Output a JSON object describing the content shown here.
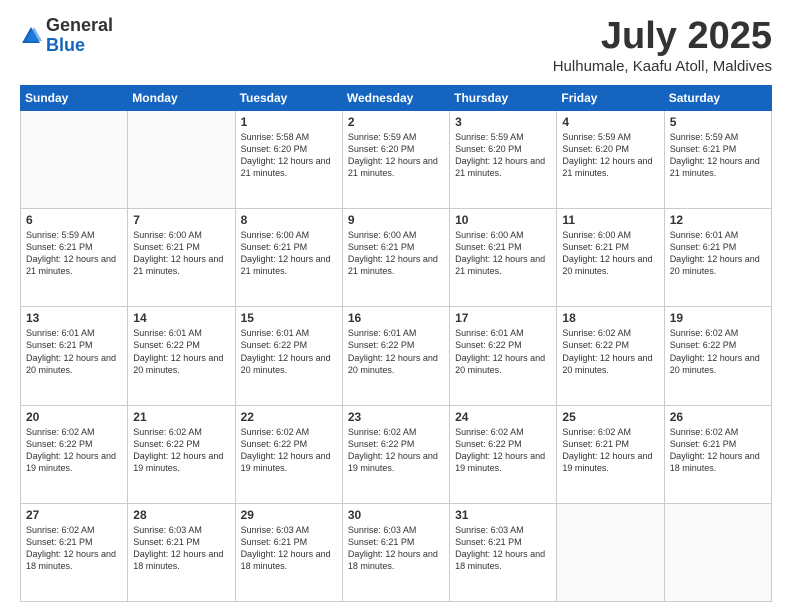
{
  "logo": {
    "general": "General",
    "blue": "Blue"
  },
  "header": {
    "month": "July 2025",
    "location": "Hulhumale, Kaafu Atoll, Maldives"
  },
  "weekdays": [
    "Sunday",
    "Monday",
    "Tuesday",
    "Wednesday",
    "Thursday",
    "Friday",
    "Saturday"
  ],
  "weeks": [
    [
      {
        "day": "",
        "info": ""
      },
      {
        "day": "",
        "info": ""
      },
      {
        "day": "1",
        "info": "Sunrise: 5:58 AM\nSunset: 6:20 PM\nDaylight: 12 hours and 21 minutes."
      },
      {
        "day": "2",
        "info": "Sunrise: 5:59 AM\nSunset: 6:20 PM\nDaylight: 12 hours and 21 minutes."
      },
      {
        "day": "3",
        "info": "Sunrise: 5:59 AM\nSunset: 6:20 PM\nDaylight: 12 hours and 21 minutes."
      },
      {
        "day": "4",
        "info": "Sunrise: 5:59 AM\nSunset: 6:20 PM\nDaylight: 12 hours and 21 minutes."
      },
      {
        "day": "5",
        "info": "Sunrise: 5:59 AM\nSunset: 6:21 PM\nDaylight: 12 hours and 21 minutes."
      }
    ],
    [
      {
        "day": "6",
        "info": "Sunrise: 5:59 AM\nSunset: 6:21 PM\nDaylight: 12 hours and 21 minutes."
      },
      {
        "day": "7",
        "info": "Sunrise: 6:00 AM\nSunset: 6:21 PM\nDaylight: 12 hours and 21 minutes."
      },
      {
        "day": "8",
        "info": "Sunrise: 6:00 AM\nSunset: 6:21 PM\nDaylight: 12 hours and 21 minutes."
      },
      {
        "day": "9",
        "info": "Sunrise: 6:00 AM\nSunset: 6:21 PM\nDaylight: 12 hours and 21 minutes."
      },
      {
        "day": "10",
        "info": "Sunrise: 6:00 AM\nSunset: 6:21 PM\nDaylight: 12 hours and 21 minutes."
      },
      {
        "day": "11",
        "info": "Sunrise: 6:00 AM\nSunset: 6:21 PM\nDaylight: 12 hours and 20 minutes."
      },
      {
        "day": "12",
        "info": "Sunrise: 6:01 AM\nSunset: 6:21 PM\nDaylight: 12 hours and 20 minutes."
      }
    ],
    [
      {
        "day": "13",
        "info": "Sunrise: 6:01 AM\nSunset: 6:21 PM\nDaylight: 12 hours and 20 minutes."
      },
      {
        "day": "14",
        "info": "Sunrise: 6:01 AM\nSunset: 6:22 PM\nDaylight: 12 hours and 20 minutes."
      },
      {
        "day": "15",
        "info": "Sunrise: 6:01 AM\nSunset: 6:22 PM\nDaylight: 12 hours and 20 minutes."
      },
      {
        "day": "16",
        "info": "Sunrise: 6:01 AM\nSunset: 6:22 PM\nDaylight: 12 hours and 20 minutes."
      },
      {
        "day": "17",
        "info": "Sunrise: 6:01 AM\nSunset: 6:22 PM\nDaylight: 12 hours and 20 minutes."
      },
      {
        "day": "18",
        "info": "Sunrise: 6:02 AM\nSunset: 6:22 PM\nDaylight: 12 hours and 20 minutes."
      },
      {
        "day": "19",
        "info": "Sunrise: 6:02 AM\nSunset: 6:22 PM\nDaylight: 12 hours and 20 minutes."
      }
    ],
    [
      {
        "day": "20",
        "info": "Sunrise: 6:02 AM\nSunset: 6:22 PM\nDaylight: 12 hours and 19 minutes."
      },
      {
        "day": "21",
        "info": "Sunrise: 6:02 AM\nSunset: 6:22 PM\nDaylight: 12 hours and 19 minutes."
      },
      {
        "day": "22",
        "info": "Sunrise: 6:02 AM\nSunset: 6:22 PM\nDaylight: 12 hours and 19 minutes."
      },
      {
        "day": "23",
        "info": "Sunrise: 6:02 AM\nSunset: 6:22 PM\nDaylight: 12 hours and 19 minutes."
      },
      {
        "day": "24",
        "info": "Sunrise: 6:02 AM\nSunset: 6:22 PM\nDaylight: 12 hours and 19 minutes."
      },
      {
        "day": "25",
        "info": "Sunrise: 6:02 AM\nSunset: 6:21 PM\nDaylight: 12 hours and 19 minutes."
      },
      {
        "day": "26",
        "info": "Sunrise: 6:02 AM\nSunset: 6:21 PM\nDaylight: 12 hours and 18 minutes."
      }
    ],
    [
      {
        "day": "27",
        "info": "Sunrise: 6:02 AM\nSunset: 6:21 PM\nDaylight: 12 hours and 18 minutes."
      },
      {
        "day": "28",
        "info": "Sunrise: 6:03 AM\nSunset: 6:21 PM\nDaylight: 12 hours and 18 minutes."
      },
      {
        "day": "29",
        "info": "Sunrise: 6:03 AM\nSunset: 6:21 PM\nDaylight: 12 hours and 18 minutes."
      },
      {
        "day": "30",
        "info": "Sunrise: 6:03 AM\nSunset: 6:21 PM\nDaylight: 12 hours and 18 minutes."
      },
      {
        "day": "31",
        "info": "Sunrise: 6:03 AM\nSunset: 6:21 PM\nDaylight: 12 hours and 18 minutes."
      },
      {
        "day": "",
        "info": ""
      },
      {
        "day": "",
        "info": ""
      }
    ]
  ]
}
